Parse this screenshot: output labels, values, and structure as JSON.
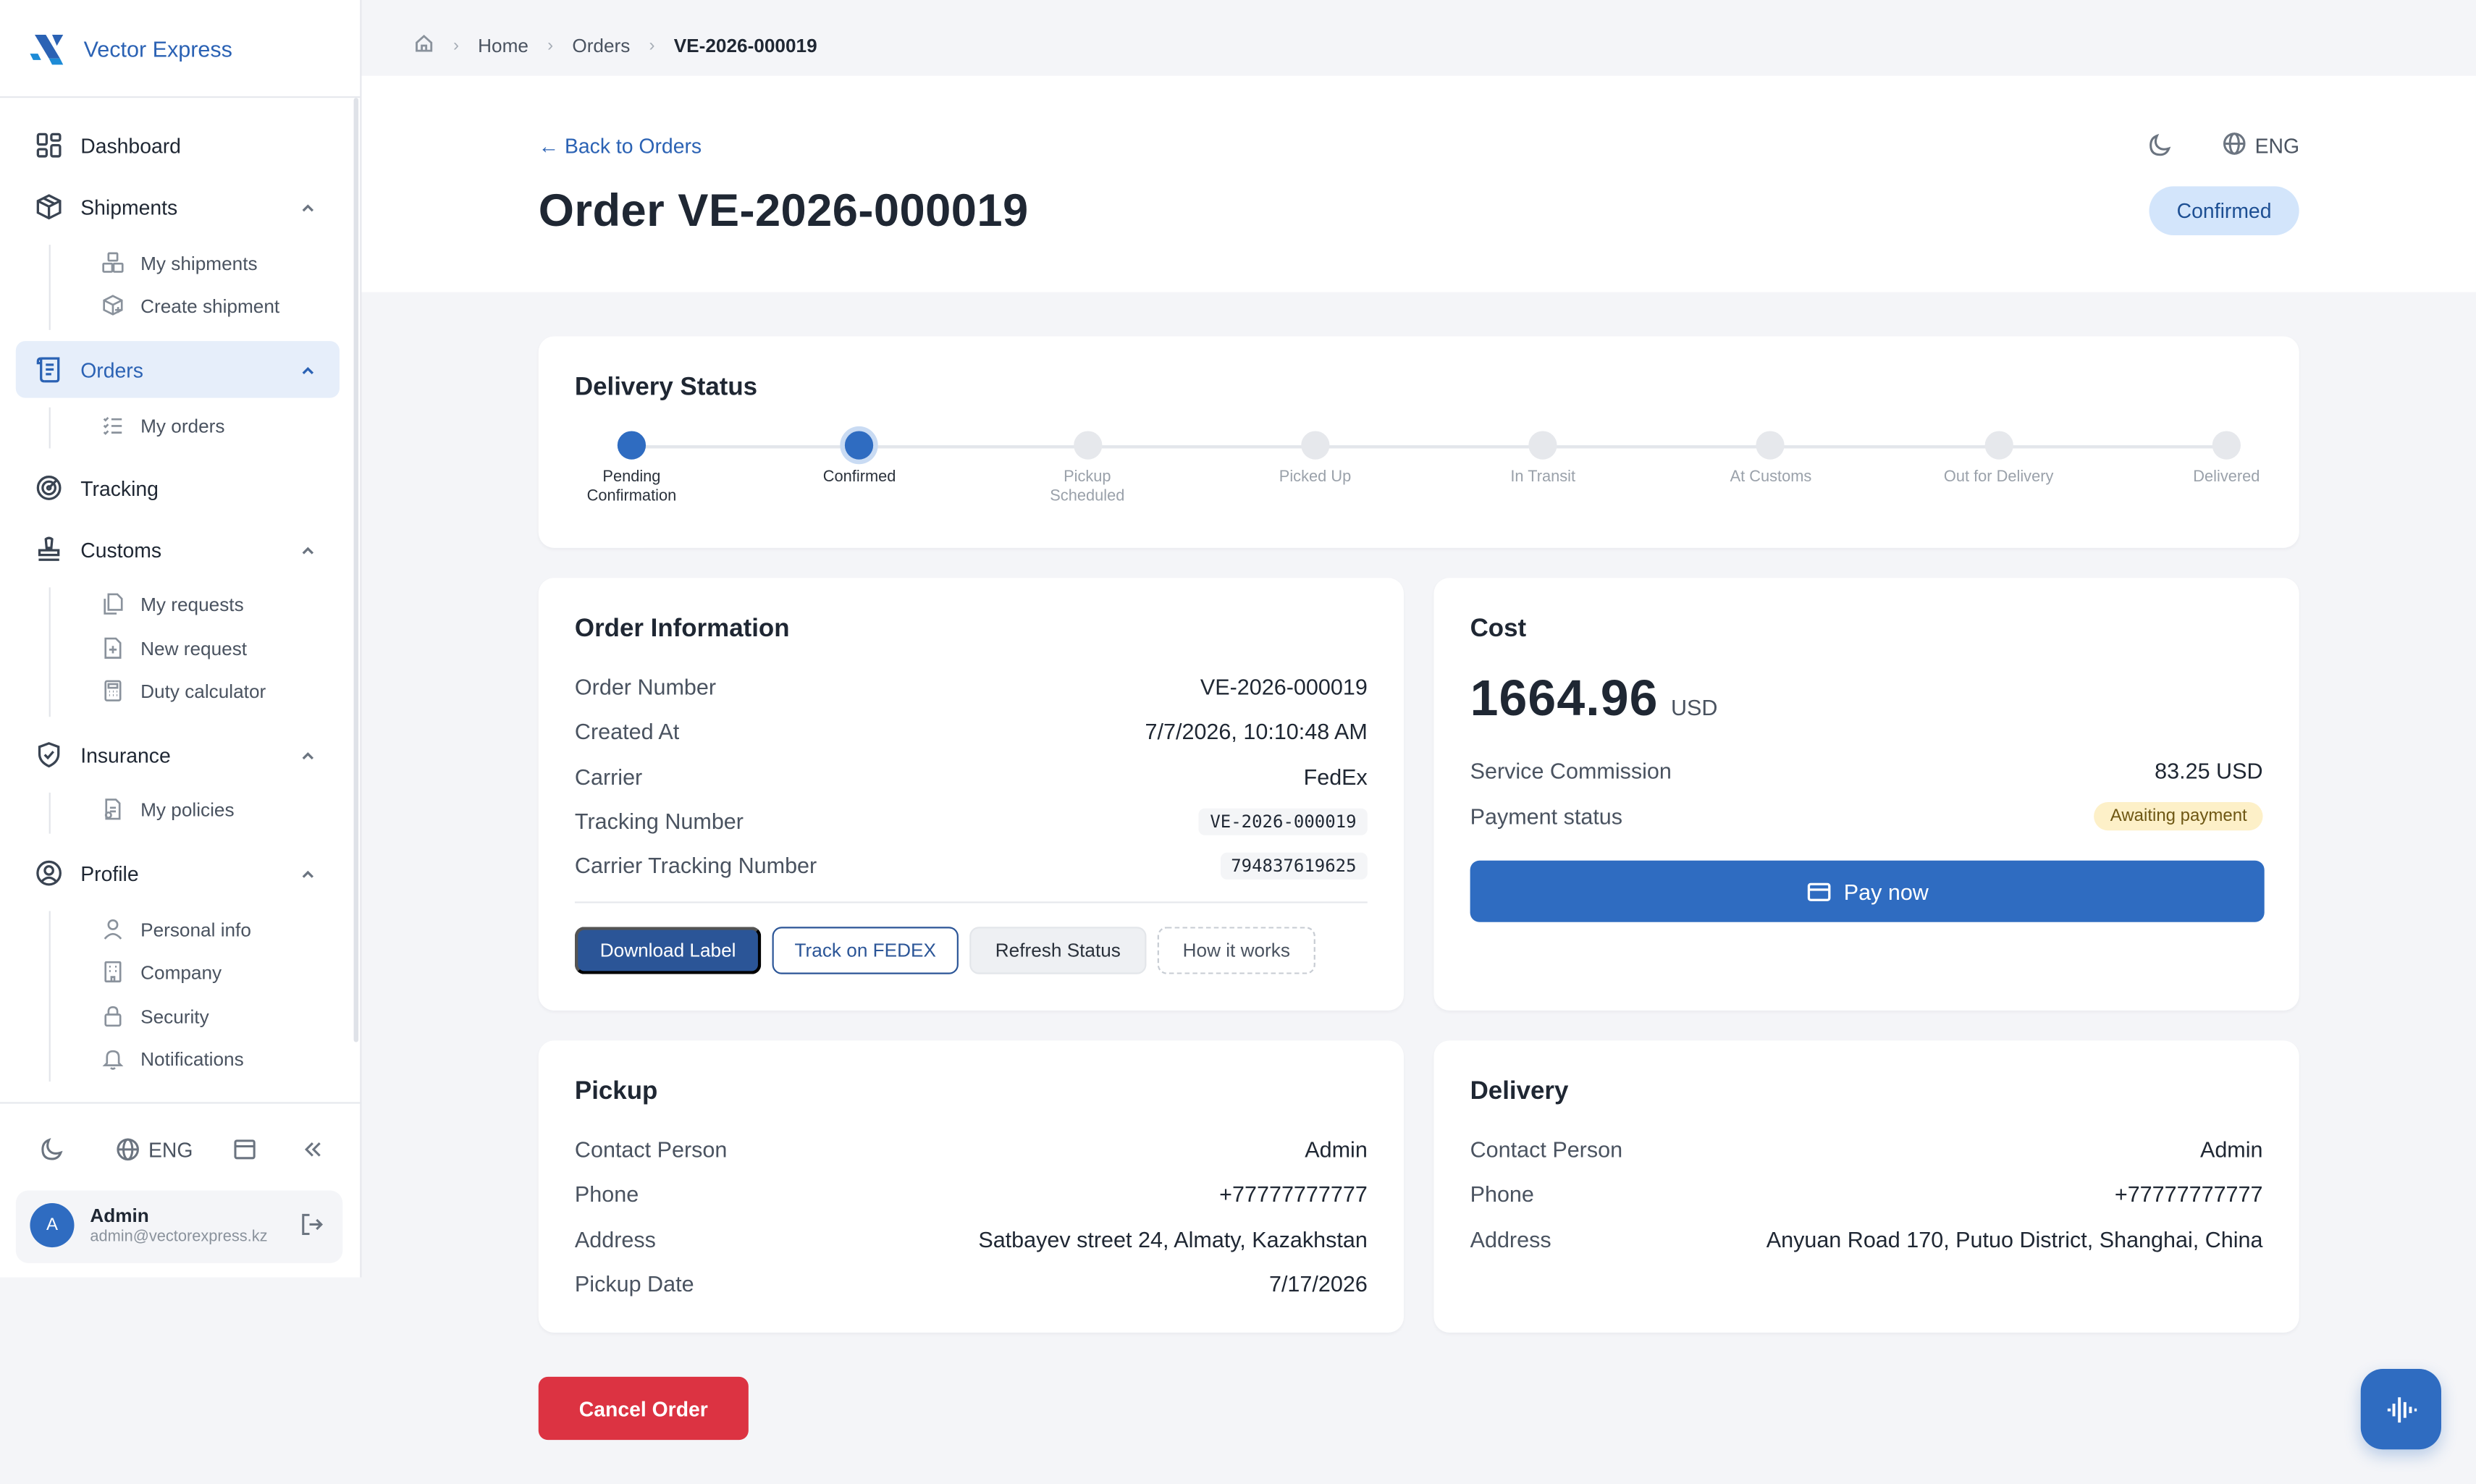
{
  "brand": {
    "name": "Vector Express"
  },
  "sidebar": {
    "items": [
      {
        "label": "Dashboard",
        "icon": "dashboard-icon"
      },
      {
        "label": "Shipments",
        "icon": "box-icon",
        "children": [
          "My shipments",
          "Create shipment"
        ]
      },
      {
        "label": "Orders",
        "icon": "orders-icon",
        "active": true,
        "children": [
          "My orders"
        ]
      },
      {
        "label": "Tracking",
        "icon": "tracking-icon"
      },
      {
        "label": "Customs",
        "icon": "stamp-icon",
        "children": [
          "My requests",
          "New request",
          "Duty calculator"
        ]
      },
      {
        "label": "Insurance",
        "icon": "shield-icon",
        "children": [
          "My policies"
        ]
      },
      {
        "label": "Profile",
        "icon": "user-circle-icon",
        "children": [
          "Personal info",
          "Company",
          "Security",
          "Notifications"
        ]
      }
    ],
    "footer": {
      "lang": "ENG"
    },
    "user": {
      "initial": "A",
      "name": "Admin",
      "email": "admin@vectorexpress.kz"
    }
  },
  "breadcrumb": [
    "Home",
    "Orders",
    "VE-2026-000019"
  ],
  "header": {
    "back_label": "← Back to Orders",
    "title": "Order VE-2026-000019",
    "lang": "ENG",
    "status": "Confirmed"
  },
  "delivery_status": {
    "title": "Delivery Status",
    "steps": [
      "Pending Confirmation",
      "Confirmed",
      "Pickup Scheduled",
      "Picked Up",
      "In Transit",
      "At Customs",
      "Out for Delivery",
      "Delivered"
    ],
    "current_index": 1
  },
  "order_info": {
    "title": "Order Information",
    "rows": [
      {
        "label": "Order Number",
        "value": "VE-2026-000019"
      },
      {
        "label": "Created At",
        "value": "7/7/2026, 10:10:48 AM"
      },
      {
        "label": "Carrier",
        "value": "FedEx"
      },
      {
        "label": "Tracking Number",
        "value": "VE-2026-000019"
      },
      {
        "label": "Carrier Tracking Number",
        "value": "794837619625"
      }
    ],
    "buttons": {
      "download": "Download Label",
      "track": "Track on FEDEX",
      "refresh": "Refresh Status",
      "how": "How it works"
    }
  },
  "cost": {
    "title": "Cost",
    "amount": "1664.96",
    "currency": "USD",
    "commission_label": "Service Commission",
    "commission_value": "83.25 USD",
    "payment_label": "Payment status",
    "payment_status": "Awaiting payment",
    "pay_button": "Pay now"
  },
  "pickup": {
    "title": "Pickup",
    "rows": [
      {
        "label": "Contact Person",
        "value": "Admin"
      },
      {
        "label": "Phone",
        "value": "+77777777777"
      },
      {
        "label": "Address",
        "value": "Satbayev street 24, Almaty, Kazakhstan"
      },
      {
        "label": "Pickup Date",
        "value": "7/17/2026"
      }
    ]
  },
  "delivery": {
    "title": "Delivery",
    "rows": [
      {
        "label": "Contact Person",
        "value": "Admin"
      },
      {
        "label": "Phone",
        "value": "+77777777777"
      },
      {
        "label": "Address",
        "value": "Anyuan Road 170, Putuo District, Shanghai, China"
      }
    ]
  },
  "actions": {
    "cancel": "Cancel Order"
  },
  "colors": {
    "accent": "#2f6cc1",
    "danger": "#dc3342",
    "status_bg": "#d3e5fb"
  }
}
